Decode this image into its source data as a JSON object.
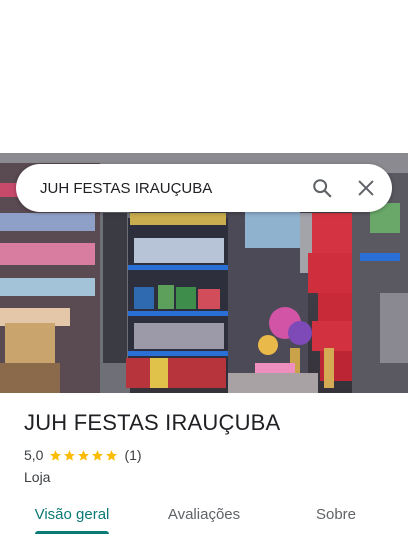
{
  "place": {
    "name": "JUH FESTAS IRAUÇUBA",
    "rating": "5,0",
    "stars": 5,
    "review_count": "(1)",
    "category": "Loja"
  },
  "search": {
    "query": "JUH FESTAS IRAUÇUBA",
    "search_icon": "search-icon",
    "close_icon": "close-icon"
  },
  "tabs": [
    {
      "label": "Visão geral",
      "active": true
    },
    {
      "label": "Avaliações",
      "active": false
    },
    {
      "label": "Sobre",
      "active": false
    }
  ],
  "colors": {
    "accent": "#0b7a74",
    "star": "#fbbc04",
    "text": "#202124",
    "secondary_text": "#5f6368"
  }
}
